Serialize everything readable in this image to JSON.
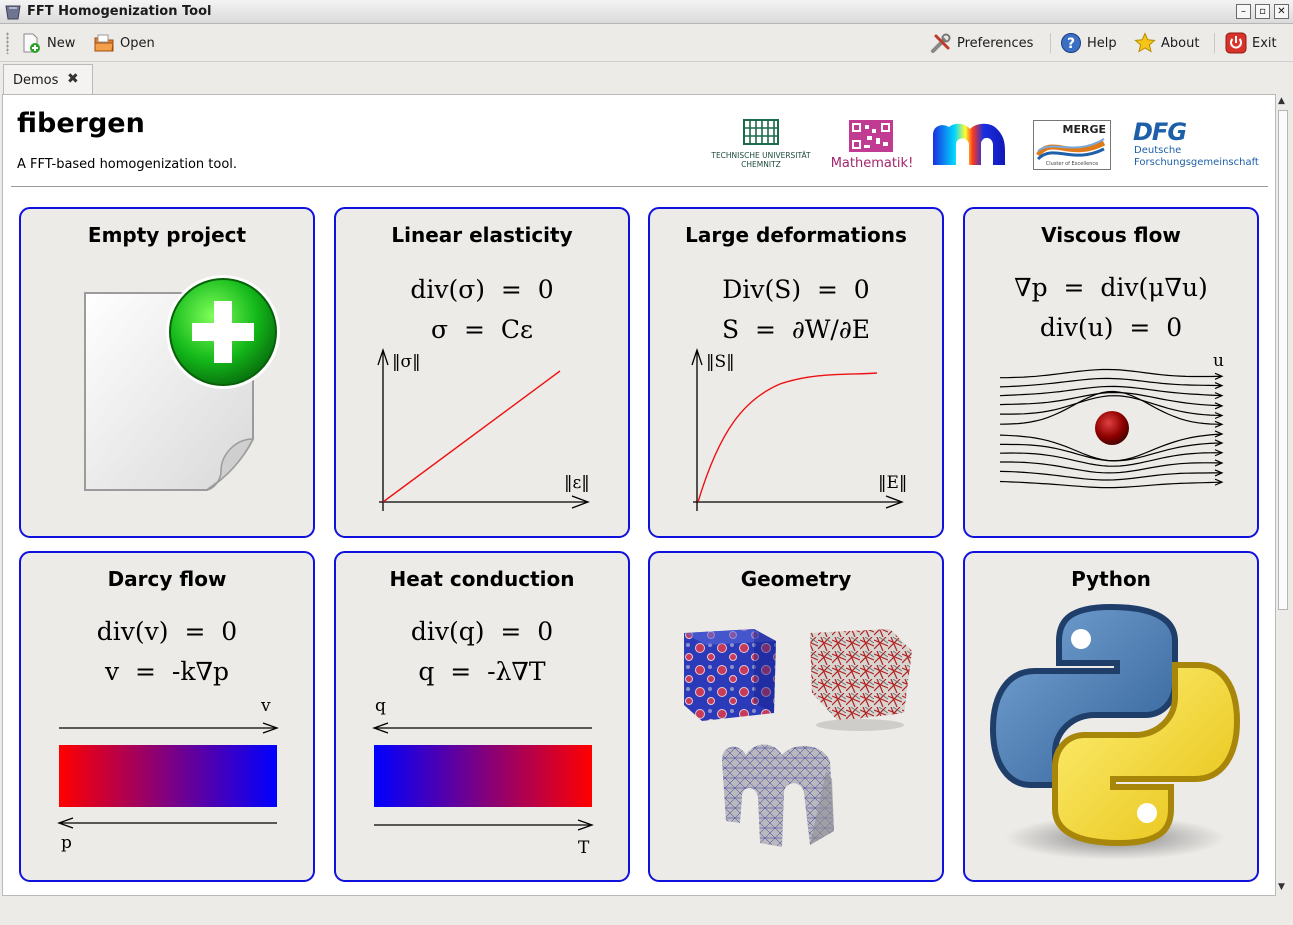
{
  "window": {
    "title": "FFT Homogenization Tool",
    "buttons": [
      "–",
      "▫",
      "✕"
    ]
  },
  "toolbar": {
    "new_label": "New",
    "open_label": "Open",
    "preferences_label": "Preferences",
    "help_label": "Help",
    "about_label": "About",
    "exit_label": "Exit"
  },
  "tabs": [
    {
      "label": "Demos",
      "close": "✖"
    }
  ],
  "header": {
    "title": "fibergen",
    "subtitle": "A FFT-based homogenization tool."
  },
  "logos": {
    "tu": [
      "TECHNISCHE UNIVERSITÄT",
      "CHEMNITZ"
    ],
    "math": "Mathematik!",
    "merge": [
      "MERGE",
      "Cluster of Excellence"
    ],
    "dfg": [
      "DFG",
      "Deutsche",
      "Forschungsgemeinschaft"
    ]
  },
  "tiles": [
    {
      "title": "Empty project",
      "eq1": "",
      "eq2": ""
    },
    {
      "title": "Linear elasticity",
      "eq1": "div(σ)  =  0",
      "eq2": "σ  =  Cε",
      "ylabel": "‖σ‖",
      "xlabel": "‖ε‖"
    },
    {
      "title": "Large deformations",
      "eq1": "Div(S)  =  0",
      "eq2": "S  =  ∂W/∂E",
      "ylabel": "‖S‖",
      "xlabel": "‖E‖"
    },
    {
      "title": "Viscous flow",
      "eq1": "∇p  =  div(μ∇u)",
      "eq2": "div(u)  =  0",
      "arrow_label": "u"
    },
    {
      "title": "Darcy flow",
      "eq1": "div(v)  =  0",
      "eq2": "v  =  -k∇p",
      "top_label": "v",
      "bottom_label": "p"
    },
    {
      "title": "Heat conduction",
      "eq1": "div(q)  =  0",
      "eq2": "q  =  -λ∇T",
      "top_label": "q",
      "bottom_label": "T"
    },
    {
      "title": "Geometry",
      "eq1": "",
      "eq2": ""
    },
    {
      "title": "Python",
      "eq1": "",
      "eq2": ""
    }
  ],
  "colors": {
    "tile_border": "#1111dd",
    "tile_bg": "#ecebe8",
    "red": "#ff0000",
    "blue": "#0000ff"
  }
}
